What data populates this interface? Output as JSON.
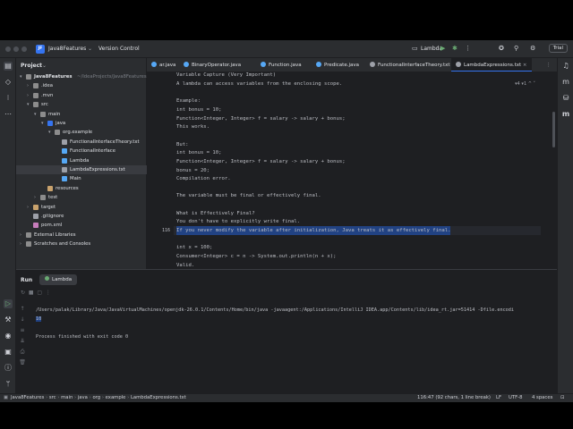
{
  "titlebar": {
    "project_badge": "JF",
    "project_name": "Java8Features",
    "vcs": "Version Control",
    "run_config": "Lambda",
    "trial": "Trial"
  },
  "project": {
    "title": "Project",
    "tree": [
      {
        "label": "Java8Features",
        "hint": "~/IdeaProjects/Java8Features",
        "indent": 0,
        "chev": "▾",
        "icon": "#8c8c8c",
        "bold": true
      },
      {
        "label": ".idea",
        "indent": 1,
        "chev": "›",
        "icon": "#8c8c8c"
      },
      {
        "label": ".mvn",
        "indent": 1,
        "chev": "›",
        "icon": "#8c8c8c"
      },
      {
        "label": "src",
        "indent": 1,
        "chev": "▾",
        "icon": "#8c8c8c"
      },
      {
        "label": "main",
        "indent": 2,
        "chev": "▾",
        "icon": "#8c8c8c"
      },
      {
        "label": "java",
        "indent": 3,
        "chev": "▾",
        "icon": "#3574f0"
      },
      {
        "label": "org.example",
        "indent": 4,
        "chev": "▾",
        "icon": "#8c8c8c"
      },
      {
        "label": "FunctionalInterfaceTheory.txt",
        "indent": 5,
        "chev": "",
        "icon": "#9da0a8"
      },
      {
        "label": "FunctionalInterface",
        "indent": 5,
        "chev": "",
        "icon": "#56a8f5"
      },
      {
        "label": "Lambda",
        "indent": 5,
        "chev": "",
        "icon": "#56a8f5"
      },
      {
        "label": "LambdaExpressions.txt",
        "indent": 5,
        "chev": "",
        "icon": "#9da0a8",
        "selected": true
      },
      {
        "label": "Main",
        "indent": 5,
        "chev": "",
        "icon": "#56a8f5"
      },
      {
        "label": "resources",
        "indent": 3,
        "chev": "",
        "icon": "#c9a26d"
      },
      {
        "label": "test",
        "indent": 2,
        "chev": "›",
        "icon": "#8c8c8c"
      },
      {
        "label": "target",
        "indent": 1,
        "chev": "›",
        "icon": "#c9a26d"
      },
      {
        "label": ".gitignore",
        "indent": 1,
        "chev": "",
        "icon": "#9da0a8"
      },
      {
        "label": "pom.xml",
        "indent": 1,
        "chev": "",
        "icon": "#c77dbb"
      },
      {
        "label": "External Libraries",
        "indent": 0,
        "chev": "›",
        "icon": "#8c8c8c"
      },
      {
        "label": "Scratches and Consoles",
        "indent": 0,
        "chev": "›",
        "icon": "#8c8c8c"
      }
    ]
  },
  "tabs": [
    {
      "label": "ar.java",
      "color": "#56a8f5"
    },
    {
      "label": "BinaryOperator.java",
      "color": "#56a8f5"
    },
    {
      "label": "Function.java",
      "color": "#56a8f5"
    },
    {
      "label": "Predicate.java",
      "color": "#56a8f5"
    },
    {
      "label": "FunctionalInterfaceTheory.txt",
      "color": "#9da0a8"
    },
    {
      "label": "LambdaExpressions.txt",
      "color": "#9da0a8",
      "active": true
    }
  ],
  "editor": {
    "inspections": "▾4 ▾1 ^ ˅",
    "first_line": "Variable Capture (Very Important)",
    "lines": [
      {
        "n": "",
        "text": "A lambda can access variables from the enclosing scope."
      },
      {
        "n": "",
        "text": ""
      },
      {
        "n": "",
        "text": "Example:"
      },
      {
        "n": "",
        "text": "int bonus = 10;"
      },
      {
        "n": "",
        "text": "Function<Integer, Integer> f = salary -> salary + bonus;"
      },
      {
        "n": "",
        "text": "This works."
      },
      {
        "n": "",
        "text": ""
      },
      {
        "n": "",
        "text": "But:"
      },
      {
        "n": "",
        "text": "int bonus = 10;"
      },
      {
        "n": "",
        "text": "Function<Integer, Integer> f = salary -> salary + bonus;"
      },
      {
        "n": "",
        "text": "bonus = 20;"
      },
      {
        "n": "",
        "text": "Compilation error."
      },
      {
        "n": "",
        "text": ""
      },
      {
        "n": "",
        "text": "The variable must be final or effectively final."
      },
      {
        "n": "",
        "text": ""
      },
      {
        "n": "",
        "text": "What is Effectively Final?"
      },
      {
        "n": "",
        "text": "You don't have to explicitly write final."
      },
      {
        "n": "116",
        "text": "If you never modify the variable after initialization, Java treats it as effectively final.",
        "highlight": true
      },
      {
        "n": "",
        "text": ""
      },
      {
        "n": "",
        "text": "int x = 100;"
      },
      {
        "n": "",
        "text": "Consumer<Integer> c = n -> System.out.println(n + x);"
      },
      {
        "n": "",
        "text": "Valid."
      }
    ]
  },
  "run": {
    "title": "Run",
    "tab": "Lambda",
    "command": "/Users/palak/Library/Java/JavaVirtualMachines/openjdk-26.0.1/Contents/Home/bin/java -javaagent:/Applications/IntelliJ IDEA.app/Contents/lib/idea_rt.jar=51414 -Dfile.encodi",
    "output": "10",
    "finished": "Process finished with exit code 0"
  },
  "status": {
    "breadcrumb": [
      "Java8Features",
      "src",
      "main",
      "java",
      "org",
      "example",
      "LambdaExpressions.txt"
    ],
    "position": "116:47 (92 chars, 1 line break)",
    "line_sep": "LF",
    "encoding": "UTF-8",
    "indent": "4 spaces"
  }
}
